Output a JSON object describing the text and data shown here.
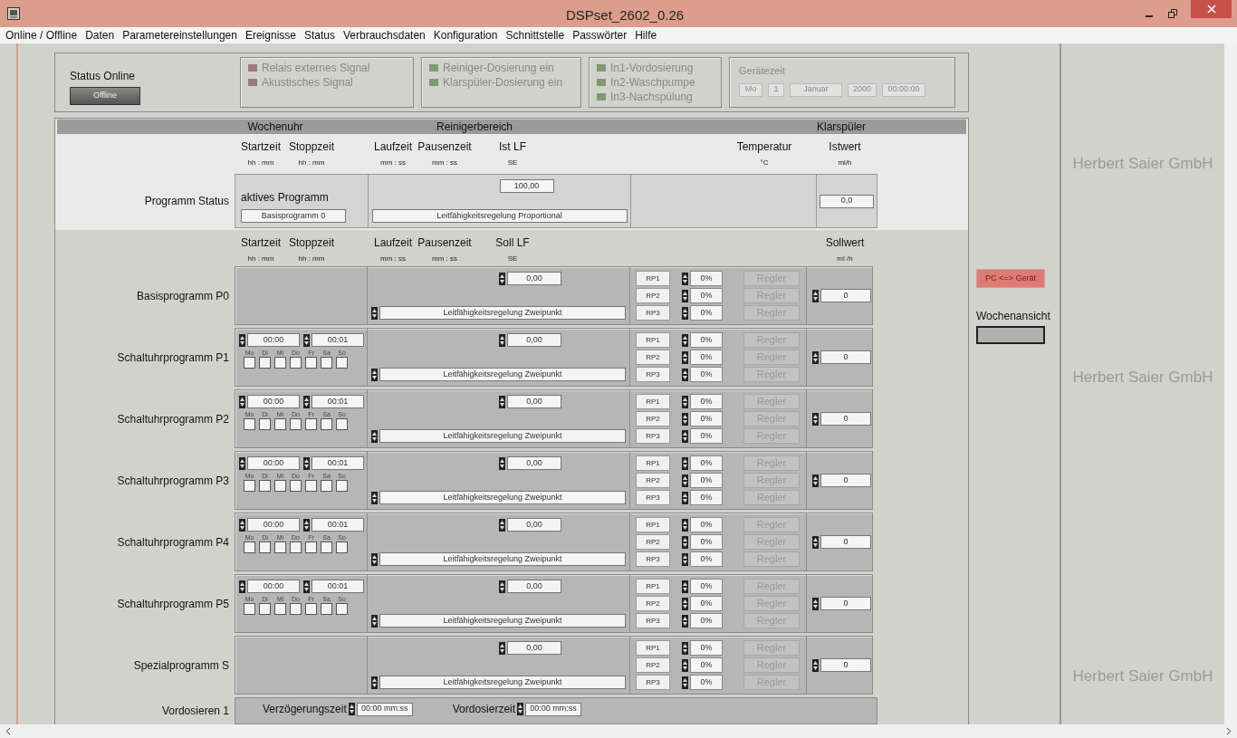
{
  "window": {
    "title": "DSPset_2602_0.26"
  },
  "menu": [
    "Online / Offline",
    "Daten",
    "Parametereinstellungen",
    "Ereignisse",
    "Status",
    "Verbrauchsdaten",
    "Konfiguration",
    "Schnittstelle",
    "Passwörter",
    "Hilfe"
  ],
  "status_online": {
    "label": "Status Online",
    "button": "Offline"
  },
  "indicator_groups": [
    [
      {
        "label": "Relais externes Signal",
        "color": "#9c7880"
      },
      {
        "label": "Akustisches Signal",
        "color": "#9c7880"
      }
    ],
    [
      {
        "label": "Reiniger-Dosierung ein",
        "color": "#7f9a72"
      },
      {
        "label": "Klarspüler-Dosierung ein",
        "color": "#7f9a72"
      }
    ],
    [
      {
        "label": "In1-Vordosierung",
        "color": "#7f9a72"
      },
      {
        "label": "In2-Waschpumpe",
        "color": "#7f9a72"
      },
      {
        "label": "In3-Nachspülung",
        "color": "#7f9a72"
      }
    ]
  ],
  "device_time": {
    "label": "Gerätezeit",
    "fields": [
      "Mo",
      "1",
      "Januar",
      "2000",
      "00:00:00"
    ]
  },
  "group_headers": [
    "Wochenuhr",
    "Reinigerbereich",
    "Klarspüler"
  ],
  "actual_columns": [
    {
      "label": "Startzeit",
      "unit": "hh : mm"
    },
    {
      "label": "Stoppzeit",
      "unit": "hh : mm"
    },
    {
      "label": "Laufzeit",
      "unit": "mm : ss"
    },
    {
      "label": "Pausenzeit",
      "unit": "mm : ss"
    },
    {
      "label": "Ist LF",
      "unit": "SE"
    },
    {
      "label": "Temperatur",
      "unit": "°C"
    },
    {
      "label": "Istwert",
      "unit": "ml/h"
    }
  ],
  "program_status": {
    "label": "Programm Status",
    "active_label": "aktives Programm",
    "active_program": "Basisprogramm  0",
    "lf": "100,00",
    "mode": "Leitfähigkeitsregelung Proportional",
    "actual_value": "0,0"
  },
  "setpoint_columns": [
    {
      "label": "Startzeit",
      "unit": "hh : mm"
    },
    {
      "label": "Stoppzeit",
      "unit": "hh : mm"
    },
    {
      "label": "Laufzeit",
      "unit": "mm : ss"
    },
    {
      "label": "Pausenzeit",
      "unit": "mm : ss"
    },
    {
      "label": "Soll LF",
      "unit": "SE"
    },
    {
      "label": "Sollwert",
      "unit": "ml /h"
    }
  ],
  "programs": [
    {
      "kind": "basic",
      "label": "Basisprogramm P0",
      "lf": "0,00",
      "mode": "Leitfähigkeitsregelung Zweipunkt",
      "rps": [
        {
          "label": "RP1",
          "value": "0%",
          "button": "Regler",
          "disabled": true
        },
        {
          "label": "RP2",
          "value": "0%",
          "button": "Regler",
          "disabled": true
        },
        {
          "label": "RP3",
          "value": "0%",
          "button": "Regler",
          "disabled": true
        }
      ],
      "setpoint": "0"
    },
    {
      "kind": "timer",
      "label": "Schaltuhrprogramm P1",
      "start": "00:00",
      "stop": "00:01",
      "days": [
        {
          "label": "Mo",
          "checked": false
        },
        {
          "label": "Di",
          "checked": false
        },
        {
          "label": "Mi",
          "checked": false
        },
        {
          "label": "Do",
          "checked": false
        },
        {
          "label": "Fr",
          "checked": false
        },
        {
          "label": "Sa",
          "checked": false
        },
        {
          "label": "So",
          "checked": false
        }
      ],
      "lf": "0,00",
      "mode": "Leitfähigkeitsregelung Zweipunkt",
      "rps": [
        {
          "label": "RP1",
          "value": "0%",
          "button": "Regler",
          "disabled": true
        },
        {
          "label": "RP2",
          "value": "0%",
          "button": "Regler",
          "disabled": true
        },
        {
          "label": "RP3",
          "value": "0%",
          "button": "Regler",
          "disabled": true
        }
      ],
      "setpoint": "0"
    },
    {
      "kind": "timer",
      "label": "Schaltuhrprogramm P2",
      "start": "00:00",
      "stop": "00:01",
      "days": [
        {
          "label": "Mo",
          "checked": false
        },
        {
          "label": "Di",
          "checked": false
        },
        {
          "label": "Mi",
          "checked": false
        },
        {
          "label": "Do",
          "checked": false
        },
        {
          "label": "Fr",
          "checked": false
        },
        {
          "label": "Sa",
          "checked": false
        },
        {
          "label": "So",
          "checked": false
        }
      ],
      "lf": "0,00",
      "mode": "Leitfähigkeitsregelung Zweipunkt",
      "rps": [
        {
          "label": "RP1",
          "value": "0%",
          "button": "Regler",
          "disabled": true
        },
        {
          "label": "RP2",
          "value": "0%",
          "button": "Regler",
          "disabled": true
        },
        {
          "label": "RP3",
          "value": "0%",
          "button": "Regler",
          "disabled": true
        }
      ],
      "setpoint": "0"
    },
    {
      "kind": "timer",
      "label": "Schaltuhrprogramm P3",
      "start": "00:00",
      "stop": "00:01",
      "days": [
        {
          "label": "Mo",
          "checked": false
        },
        {
          "label": "Di",
          "checked": false
        },
        {
          "label": "Mi",
          "checked": false
        },
        {
          "label": "Do",
          "checked": false
        },
        {
          "label": "Fr",
          "checked": false
        },
        {
          "label": "Sa",
          "checked": false
        },
        {
          "label": "So",
          "checked": false
        }
      ],
      "lf": "0,00",
      "mode": "Leitfähigkeitsregelung Zweipunkt",
      "rps": [
        {
          "label": "RP1",
          "value": "0%",
          "button": "Regler",
          "disabled": true
        },
        {
          "label": "RP2",
          "value": "0%",
          "button": "Regler",
          "disabled": true
        },
        {
          "label": "RP3",
          "value": "0%",
          "button": "Regler",
          "disabled": true
        }
      ],
      "setpoint": "0"
    },
    {
      "kind": "timer",
      "label": "Schaltuhrprogramm P4",
      "start": "00:00",
      "stop": "00:01",
      "days": [
        {
          "label": "Mo",
          "checked": false
        },
        {
          "label": "Di",
          "checked": false
        },
        {
          "label": "Mi",
          "checked": false
        },
        {
          "label": "Do",
          "checked": false
        },
        {
          "label": "Fr",
          "checked": false
        },
        {
          "label": "Sa",
          "checked": false
        },
        {
          "label": "So",
          "checked": false
        }
      ],
      "lf": "0,00",
      "mode": "Leitfähigkeitsregelung Zweipunkt",
      "rps": [
        {
          "label": "RP1",
          "value": "0%",
          "button": "Regler",
          "disabled": true
        },
        {
          "label": "RP2",
          "value": "0%",
          "button": "Regler",
          "disabled": true
        },
        {
          "label": "RP3",
          "value": "0%",
          "button": "Regler",
          "disabled": true
        }
      ],
      "setpoint": "0"
    },
    {
      "kind": "timer",
      "label": "Schaltuhrprogramm P5",
      "start": "00:00",
      "stop": "00:01",
      "days": [
        {
          "label": "Mo",
          "checked": false
        },
        {
          "label": "Di",
          "checked": false
        },
        {
          "label": "Mi",
          "checked": false
        },
        {
          "label": "Do",
          "checked": false
        },
        {
          "label": "Fr",
          "checked": false
        },
        {
          "label": "Sa",
          "checked": false
        },
        {
          "label": "So",
          "checked": false
        }
      ],
      "lf": "0,00",
      "mode": "Leitfähigkeitsregelung Zweipunkt",
      "rps": [
        {
          "label": "RP1",
          "value": "0%",
          "button": "Regler",
          "disabled": true
        },
        {
          "label": "RP2",
          "value": "0%",
          "button": "Regler",
          "disabled": true
        },
        {
          "label": "RP3",
          "value": "0%",
          "button": "Regler",
          "disabled": true
        }
      ],
      "setpoint": "0"
    },
    {
      "kind": "basic",
      "label": "Spezialprogramm  S",
      "lf": "0,00",
      "mode": "Leitfähigkeitsregelung Zweipunkt",
      "rps": [
        {
          "label": "RP1",
          "value": "0%",
          "button": "Regler",
          "disabled": true
        },
        {
          "label": "RP2",
          "value": "0%",
          "button": "Regler",
          "disabled": true
        },
        {
          "label": "RP3",
          "value": "0%",
          "button": "Regler",
          "disabled": true
        }
      ],
      "setpoint": "0"
    }
  ],
  "predose": {
    "label": "Vordosieren 1",
    "fields": [
      {
        "label": "Verzögerungszeit",
        "value": "00:00 mm:ss"
      },
      {
        "label": "Vordosierzeit",
        "value": "00:00 mm:ss"
      }
    ]
  },
  "sync_button": "PC <=> Gerät",
  "week_view": {
    "label": "Wochenansicht"
  },
  "background_texts": [
    "Herbert Saier GmbH",
    "Herbert Saier GmbH",
    "Herbert Saier GmbH"
  ]
}
